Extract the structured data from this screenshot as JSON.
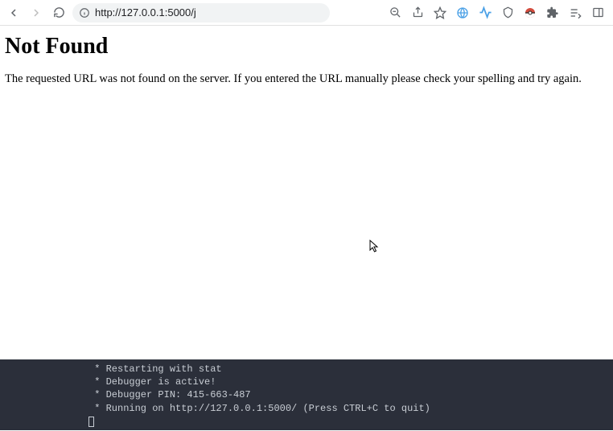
{
  "browser": {
    "url": "http://127.0.0.1:5000/j"
  },
  "page": {
    "heading": "Not Found",
    "message": "The requested URL was not found on the server. If you entered the URL manually please check your spelling and try again."
  },
  "terminal": {
    "lines": [
      " * Restarting with stat",
      " * Debugger is active!",
      " * Debugger PIN: 415-663-487",
      " * Running on http://127.0.0.1:5000/ (Press CTRL+C to quit)"
    ]
  }
}
